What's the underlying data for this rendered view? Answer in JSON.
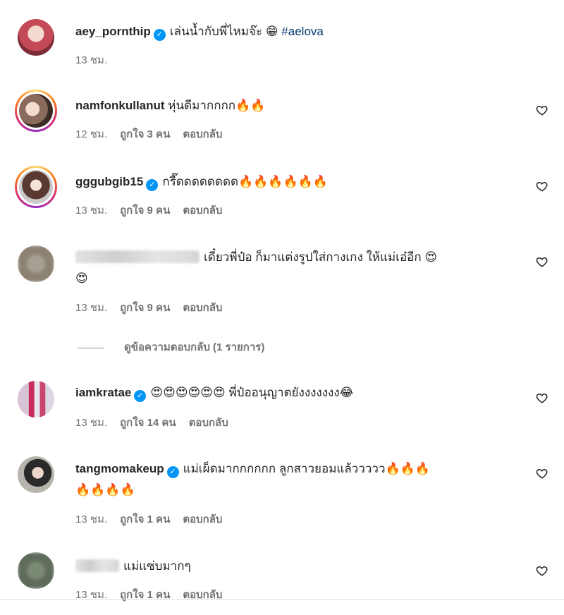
{
  "comments": [
    {
      "user": "aey_pornthip",
      "verified": true,
      "text": "เล่นน้ำกับพี่ไหมจ๊ะ 😁",
      "hashtag": "#aelova",
      "time": "13 ชม.",
      "likes": "",
      "reply": ""
    },
    {
      "user": "namfonkullanut",
      "verified": false,
      "text": "หุ่นดีมากกกก🔥🔥",
      "time": "12 ชม.",
      "likes": "ถูกใจ 3 คน",
      "reply": "ตอบกลับ"
    },
    {
      "user": "gggubgib15",
      "verified": true,
      "text": "กรี๊ดดดดดดดด🔥🔥🔥🔥🔥🔥",
      "time": "13 ชม.",
      "likes": "ถูกใจ 9 คน",
      "reply": "ตอบกลับ"
    },
    {
      "user": "",
      "verified": false,
      "text_line1": "เดี๋ยวพี่ป๋อ ก็มาแต่งรูปใส่กางเกง ให้แม่เอ๋อีก 😍",
      "text_line2": "😍",
      "time": "13 ชม.",
      "likes": "ถูกใจ 9 คน",
      "reply": "ตอบกลับ"
    },
    {
      "user": "iamkratae",
      "verified": true,
      "text": "😍😍😍😍😍😍 พี่ป๋ออนุญาตยังงงงงงง😂",
      "time": "13 ชม.",
      "likes": "ถูกใจ 14 คน",
      "reply": "ตอบกลับ"
    },
    {
      "user": "tangmomakeup",
      "verified": true,
      "text_line1": "แม่เผ็ดมากกกกกก ลูกสาวยอมแล้ววววว🔥🔥🔥",
      "text_line2": "🔥🔥🔥🔥",
      "time": "13 ชม.",
      "likes": "ถูกใจ 1 คน",
      "reply": "ตอบกลับ"
    },
    {
      "user": "",
      "verified": false,
      "text": "แม่แซ่บมากๆ",
      "time": "13 ชม.",
      "likes": "ถูกใจ 1 คน",
      "reply": "ตอบกลับ"
    }
  ],
  "view_replies": "ดูข้อความตอบกลับ (1 รายการ)",
  "icons": {
    "verified": "verified-badge-icon",
    "like": "heart-outline-icon"
  },
  "colors": {
    "verified": "#0095f6",
    "hashtag": "#00376b",
    "meta": "#737373"
  }
}
